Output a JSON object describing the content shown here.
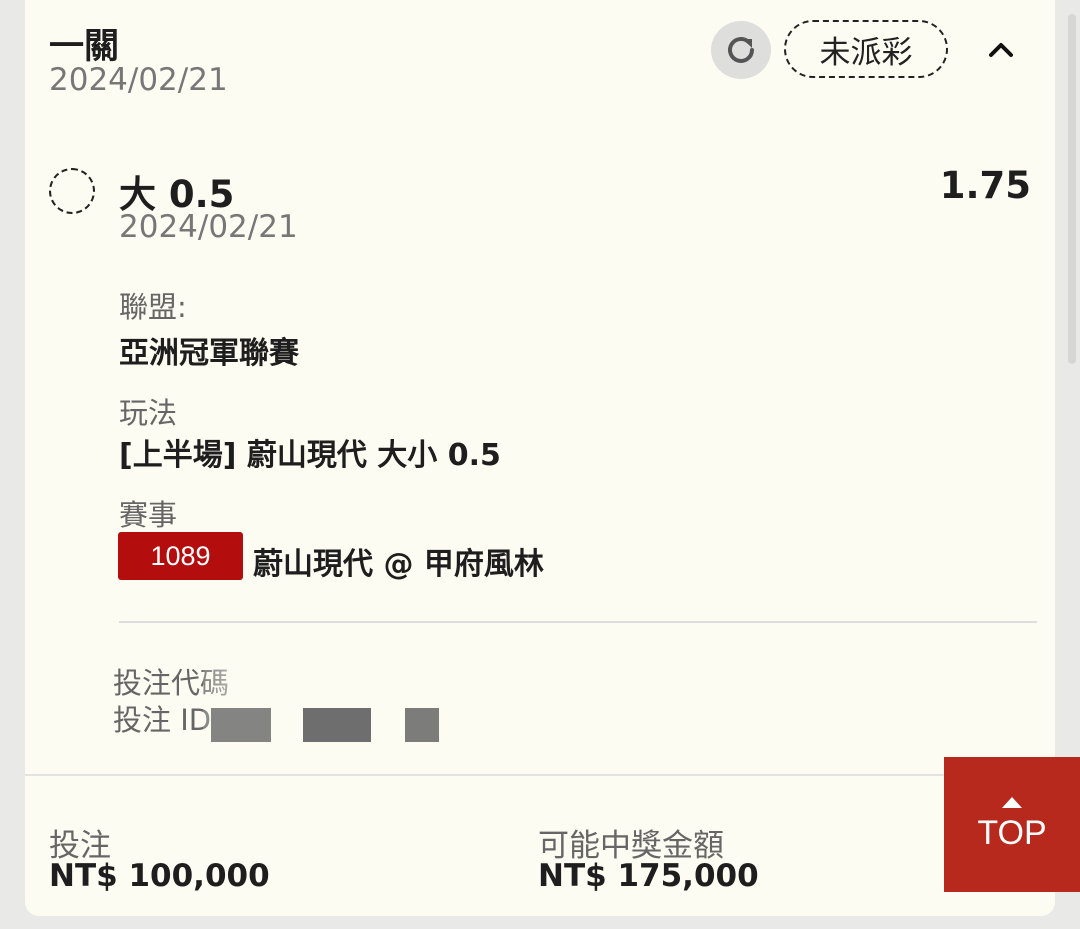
{
  "header": {
    "bet_type": "一關",
    "date": "2024/02/21",
    "status": "未派彩"
  },
  "selection": {
    "name": "大 0.5",
    "odds": "1.75",
    "date": "2024/02/21"
  },
  "details": {
    "league_label": "聯盟:",
    "league_value": "亞洲冠軍聯賽",
    "market_label": "玩法",
    "market_value": "[上半場] 蔚山現代 大小 0.5",
    "event_label": "賽事",
    "event_number": "1089",
    "event_name": "蔚山現代 @ 甲府風林"
  },
  "codes": {
    "bet_code_label": "投注代碼",
    "bet_id_label": "投注 ID"
  },
  "footer": {
    "stake_label": "投注",
    "stake_value": "NT$ 100,000",
    "payout_label": "可能中獎金額",
    "payout_value": "NT$ 175,000",
    "top_label": "TOP"
  },
  "colors": {
    "card_bg": "#fdfcf3",
    "page_bg": "#e9e9e7",
    "event_badge": "#b30d0d",
    "top_button": "#b7281d"
  },
  "icons": {
    "refresh": "refresh-icon",
    "collapse": "chevron-up-icon",
    "top": "arrow-up-icon"
  }
}
